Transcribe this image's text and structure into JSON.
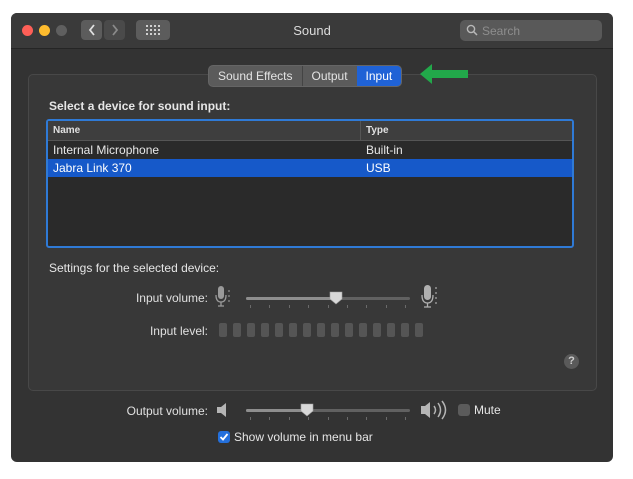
{
  "window": {
    "title": "Sound"
  },
  "search": {
    "placeholder": "Search"
  },
  "tabs": [
    {
      "label": "Sound Effects",
      "active": false
    },
    {
      "label": "Output",
      "active": false
    },
    {
      "label": "Input",
      "active": true
    }
  ],
  "input": {
    "select_label": "Select a device for sound input:",
    "table": {
      "columns": [
        "Name",
        "Type"
      ],
      "rows": [
        {
          "name": "Internal Microphone",
          "type": "Built-in",
          "selected": false
        },
        {
          "name": "Jabra Link 370",
          "type": "USB",
          "selected": true
        }
      ]
    },
    "settings_label": "Settings for the selected device:",
    "input_volume_label": "Input volume:",
    "input_volume_level": 0.55,
    "input_level_label": "Input level:",
    "input_level_segments": 15,
    "input_level_lit": 0
  },
  "output": {
    "volume_label": "Output volume:",
    "volume_level": 0.37,
    "mute_label": "Mute",
    "mute_checked": false,
    "show_in_menu_bar_label": "Show volume in menu bar",
    "show_in_menu_bar_checked": true
  },
  "help": {
    "label": "?"
  },
  "colors": {
    "accent": "#1f62d6",
    "selection": "#1659c9",
    "annotation_arrow": "#22a84a",
    "window_bg": "#333333"
  },
  "icons": {
    "close": "red-circle",
    "minimize": "yellow-circle",
    "zoom": "gray-circle",
    "back": "chevron-left-icon",
    "forward": "chevron-right-icon",
    "show_all": "grid-icon",
    "search": "magnifier-icon",
    "mic_low": "microphone-low-icon",
    "mic_high": "microphone-high-icon",
    "speaker_low": "speaker-low-icon",
    "speaker_high": "speaker-high-icon",
    "arrow": "green-arrow-icon"
  }
}
